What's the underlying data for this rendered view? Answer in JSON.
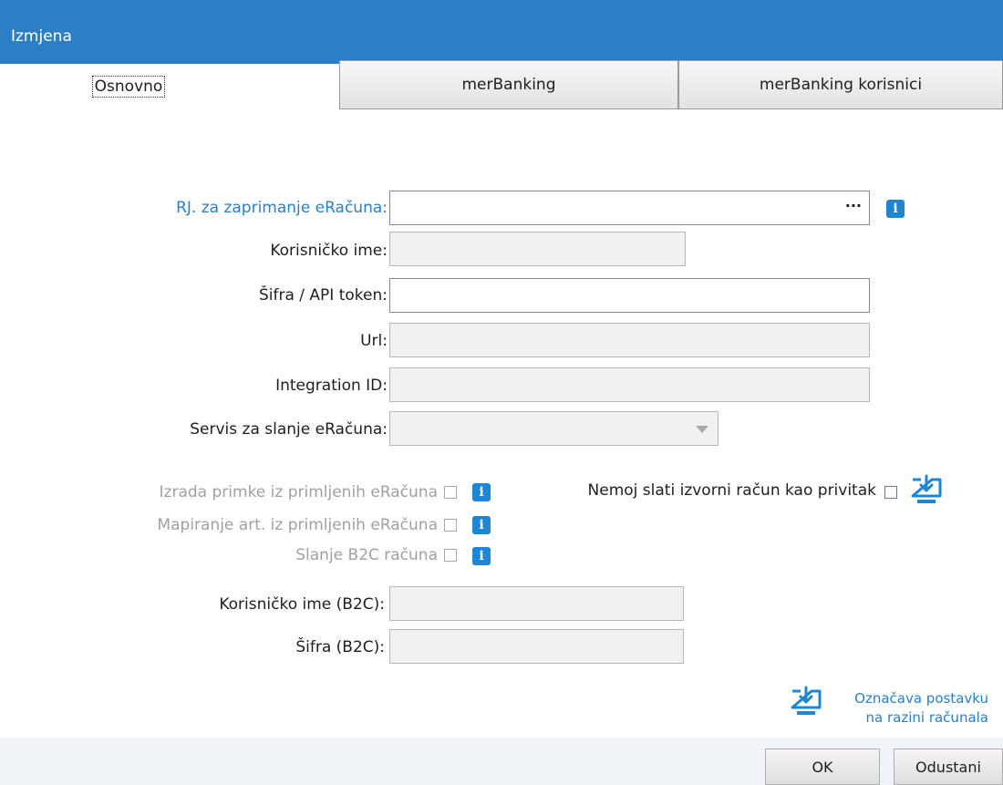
{
  "window": {
    "title": "Izmjena"
  },
  "tabs": [
    {
      "label": "Osnovno"
    },
    {
      "label": "merBanking"
    },
    {
      "label": "merBanking korisnici"
    }
  ],
  "form": {
    "rj_label": "RJ. za zaprimanje eRačuna:",
    "rj_value": "",
    "rj_browse": "···",
    "korisnicko_ime_label": "Korisničko ime:",
    "korisnicko_ime_value": "",
    "sifra_label": "Šifra / API token:",
    "sifra_value": "",
    "url_label": "Url:",
    "url_value": "",
    "integration_label": "Integration ID:",
    "integration_value": "",
    "servis_label": "Servis za slanje eRačuna:",
    "servis_value": "",
    "izrada_label": "Izrada primke iz primljenih eRačuna",
    "mapiranje_label": "Mapiranje art. iz primljenih eRačuna",
    "slanje_label": "Slanje B2C računa",
    "nemoj_label": "Nemoj slati izvorni račun kao privitak",
    "b2c_user_label": "Korisničko ime (B2C):",
    "b2c_user_value": "",
    "b2c_pass_label": "Šifra (B2C):",
    "b2c_pass_value": ""
  },
  "hint": {
    "line1": "Označava postavku",
    "line2": "na razini računala"
  },
  "buttons": {
    "ok": "OK",
    "cancel": "Odustani"
  },
  "icons": {
    "info": "i",
    "download": "download-to-computer-icon"
  },
  "colors": {
    "accent": "#2a7fc6",
    "info_badge": "#1f86d6"
  }
}
